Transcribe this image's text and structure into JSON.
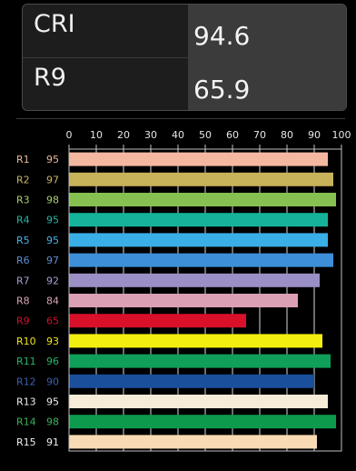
{
  "summary": {
    "cri_label": "CRI",
    "cri_value": "94.6",
    "r9_label": "R9",
    "r9_value": "65.9"
  },
  "chart_data": {
    "type": "bar",
    "orientation": "horizontal",
    "xlim": [
      0,
      100
    ],
    "xticks": [
      "0",
      "10",
      "20",
      "30",
      "40",
      "50",
      "60",
      "70",
      "80",
      "90",
      "100"
    ],
    "grid": true,
    "categories": [
      "R1",
      "R2",
      "R3",
      "R4",
      "R5",
      "R6",
      "R7",
      "R8",
      "R9",
      "R10",
      "R11",
      "R12",
      "R13",
      "R14",
      "R15"
    ],
    "values": [
      95,
      97,
      98,
      95,
      95,
      97,
      92,
      84,
      65,
      93,
      96,
      90,
      95,
      98,
      91
    ],
    "bar_colors": [
      "#f4b8a0",
      "#c8b25a",
      "#86c050",
      "#14b39a",
      "#3aaee6",
      "#3d8fd9",
      "#9b8fc6",
      "#dba0b4",
      "#d8102a",
      "#f2ee10",
      "#0f9f58",
      "#1a4f9c",
      "#f6ecd8",
      "#0e9a4e",
      "#f8dab4"
    ],
    "label_colors": [
      "#e8b89a",
      "#c9b56a",
      "#a9cf70",
      "#25b7a8",
      "#4eb2e8",
      "#5f8fd2",
      "#aaa0d0",
      "#d8a5b8",
      "#d01030",
      "#f0e41a",
      "#27b66a",
      "#3e5fb0",
      "#f0f0f0",
      "#3ab55a",
      "#f0f0f0"
    ]
  }
}
